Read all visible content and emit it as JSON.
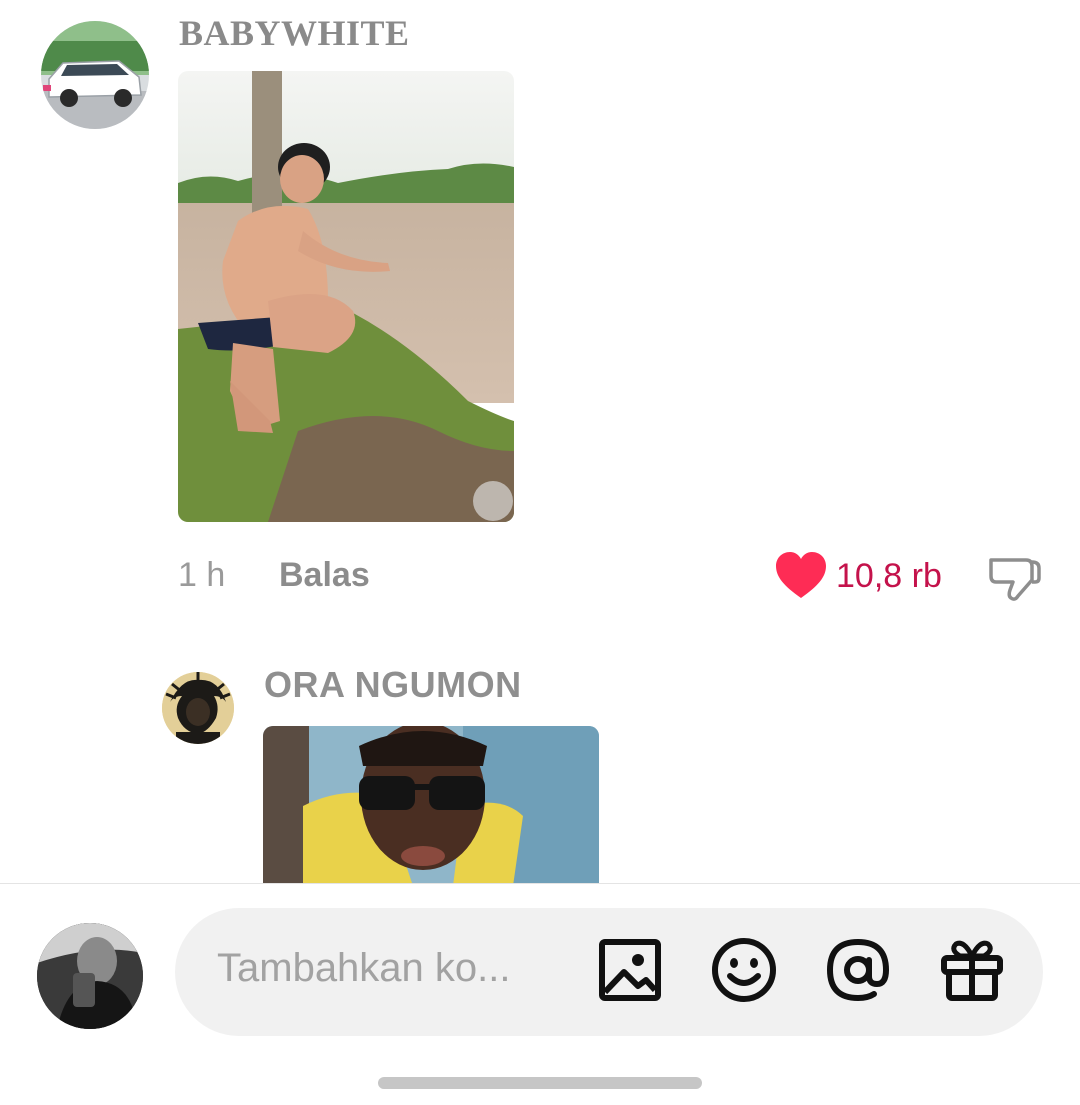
{
  "comments": [
    {
      "username": "BABYWHITE",
      "time": "1 h",
      "reply_label": "Balas",
      "like_count": "10,8 rb",
      "liked": true
    },
    {
      "username": "ORA NGUMON"
    }
  ],
  "composer": {
    "placeholder": "Tambahkan ko..."
  },
  "colors": {
    "like_red": "#fe2c55",
    "like_count": "#c4124b",
    "muted_text": "#8a8a8a",
    "input_bg": "#f1f1f1"
  },
  "icons": {
    "like": "heart-icon",
    "dislike": "thumbs-down-icon",
    "image": "image-icon",
    "emoji": "emoji-icon",
    "mention": "at-mention-icon",
    "gift": "gift-icon"
  }
}
